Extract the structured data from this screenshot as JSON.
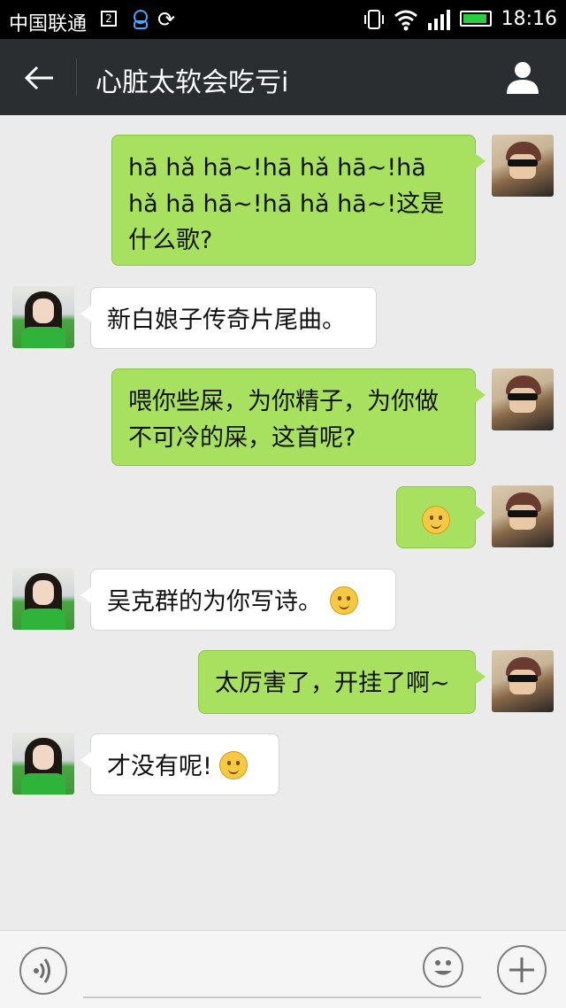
{
  "status_bar": {
    "carrier": "中国联通",
    "time": "18:16",
    "icons": [
      "sim-icon",
      "qq-icon",
      "sync-icon",
      "vibrate-icon",
      "wifi-icon",
      "signal-icon",
      "battery-icon"
    ]
  },
  "header": {
    "back_icon": "arrow-left-icon",
    "title": "心脏太软会吃亏i",
    "profile_icon": "person-icon"
  },
  "messages": [
    {
      "sender": "me",
      "text": "hā hǎ hā~!hā hǎ hā~!hā hǎ hā hā~!hā hǎ hā~!这是什么歌?"
    },
    {
      "sender": "her",
      "text": "新白娘子传奇片尾曲。"
    },
    {
      "sender": "me",
      "text": "喂你些屎，为你精子，为你做不可冷的屎，这首呢?"
    },
    {
      "sender": "me",
      "text": "",
      "emoji": "wink-tongue-emoji"
    },
    {
      "sender": "her",
      "text": "吴克群的为你写诗。",
      "emoji": "smile-emoji"
    },
    {
      "sender": "me",
      "text": "太厉害了，开挂了啊~"
    },
    {
      "sender": "her",
      "text": "才没有呢!",
      "emoji": "sweat-emoji"
    }
  ],
  "input_bar": {
    "voice_icon": "voice-icon",
    "placeholder": "",
    "emoji_icon": "smiley-icon",
    "plus_icon": "plus-icon"
  },
  "colors": {
    "header_bg": "#2a2e31",
    "chat_bg": "#ebebeb",
    "my_bubble": "#a8e05f",
    "their_bubble": "#ffffff"
  }
}
